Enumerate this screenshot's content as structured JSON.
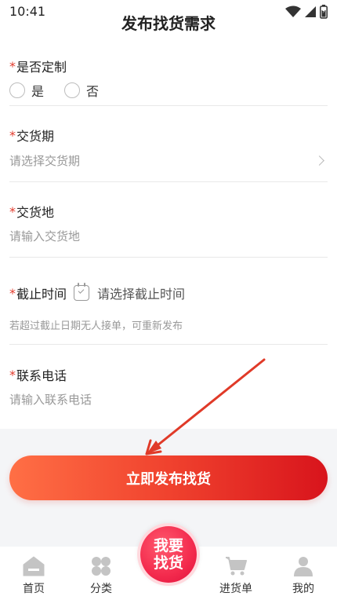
{
  "status_bar": {
    "time": "10:41"
  },
  "header": {
    "title": "发布找货需求"
  },
  "form": {
    "required_mark": "*",
    "customize": {
      "label": "是否定制",
      "options": [
        "是",
        "否"
      ]
    },
    "delivery_period": {
      "label": "交货期",
      "placeholder": "请选择交货期"
    },
    "delivery_place": {
      "label": "交货地",
      "placeholder": "请输入交货地"
    },
    "deadline": {
      "label": "截止时间",
      "placeholder": "请选择截止时间",
      "hint": "若超过截止日期无人接单，可重新发布"
    },
    "phone": {
      "label": "联系电话",
      "placeholder": "请输入联系电话"
    }
  },
  "cta": {
    "label": "立即发布找货"
  },
  "tabbar": {
    "items": [
      {
        "label": "首页",
        "icon": "home-icon"
      },
      {
        "label": "分类",
        "icon": "category-icon"
      },
      {
        "label": "进货单",
        "icon": "cart-icon"
      },
      {
        "label": "我的",
        "icon": "user-icon"
      }
    ],
    "center": {
      "line1": "我要",
      "line2": "找货"
    }
  },
  "colors": {
    "accent": "#e23b2d",
    "cta_start": "#ff6f45",
    "cta_end": "#d8141c",
    "center_button": "#f32a4d",
    "tab_icon": "#bfbfbf"
  }
}
